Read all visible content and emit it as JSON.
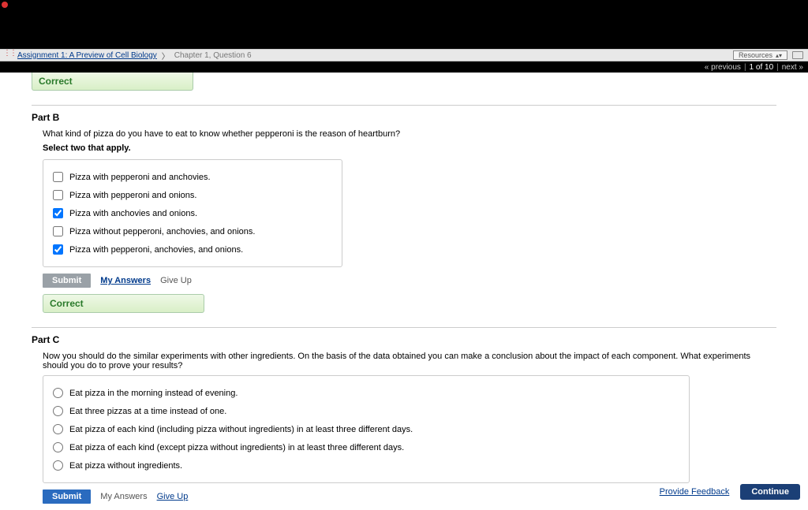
{
  "header": {
    "assignment_link": "Assignment 1: A Preview of Cell Biology",
    "chapter": "Chapter 1, Question 6",
    "resources_label": "Resources",
    "prev": "« previous",
    "counter": "1 of 10",
    "next": "next »"
  },
  "topbox": {
    "label": "Correct"
  },
  "partB": {
    "title": "Part B",
    "question": "What kind of pizza do you have to eat to know whether pepperoni is the reason of heartburn?",
    "instruction": "Select two that apply.",
    "choices": [
      {
        "label": "Pizza with pepperoni and anchovies.",
        "checked": false
      },
      {
        "label": "Pizza with pepperoni and onions.",
        "checked": false
      },
      {
        "label": "Pizza with anchovies and onions.",
        "checked": true
      },
      {
        "label": "Pizza without pepperoni, anchovies, and onions.",
        "checked": false
      },
      {
        "label": "Pizza with pepperoni, anchovies, and onions.",
        "checked": true
      }
    ],
    "submit": "Submit",
    "my_answers": "My Answers",
    "give_up": "Give Up",
    "result": "Correct"
  },
  "partC": {
    "title": "Part C",
    "question": "Now you should do the similar experiments with other ingredients. On the basis of the data obtained you can make a conclusion about the impact of each component. What experiments should you do to prove your results?",
    "choices": [
      {
        "label": "Eat pizza in the morning instead of evening."
      },
      {
        "label": "Eat three pizzas at a time instead of one."
      },
      {
        "label": "Eat pizza of each kind (including pizza without ingredients) in at least three different days."
      },
      {
        "label": "Eat pizza of each kind (except pizza without ingredients) in at least three different days."
      },
      {
        "label": "Eat pizza without ingredients."
      }
    ],
    "submit": "Submit",
    "my_answers": "My Answers",
    "give_up": "Give Up"
  },
  "footer": {
    "feedback": "Provide Feedback",
    "continue": "Continue"
  }
}
